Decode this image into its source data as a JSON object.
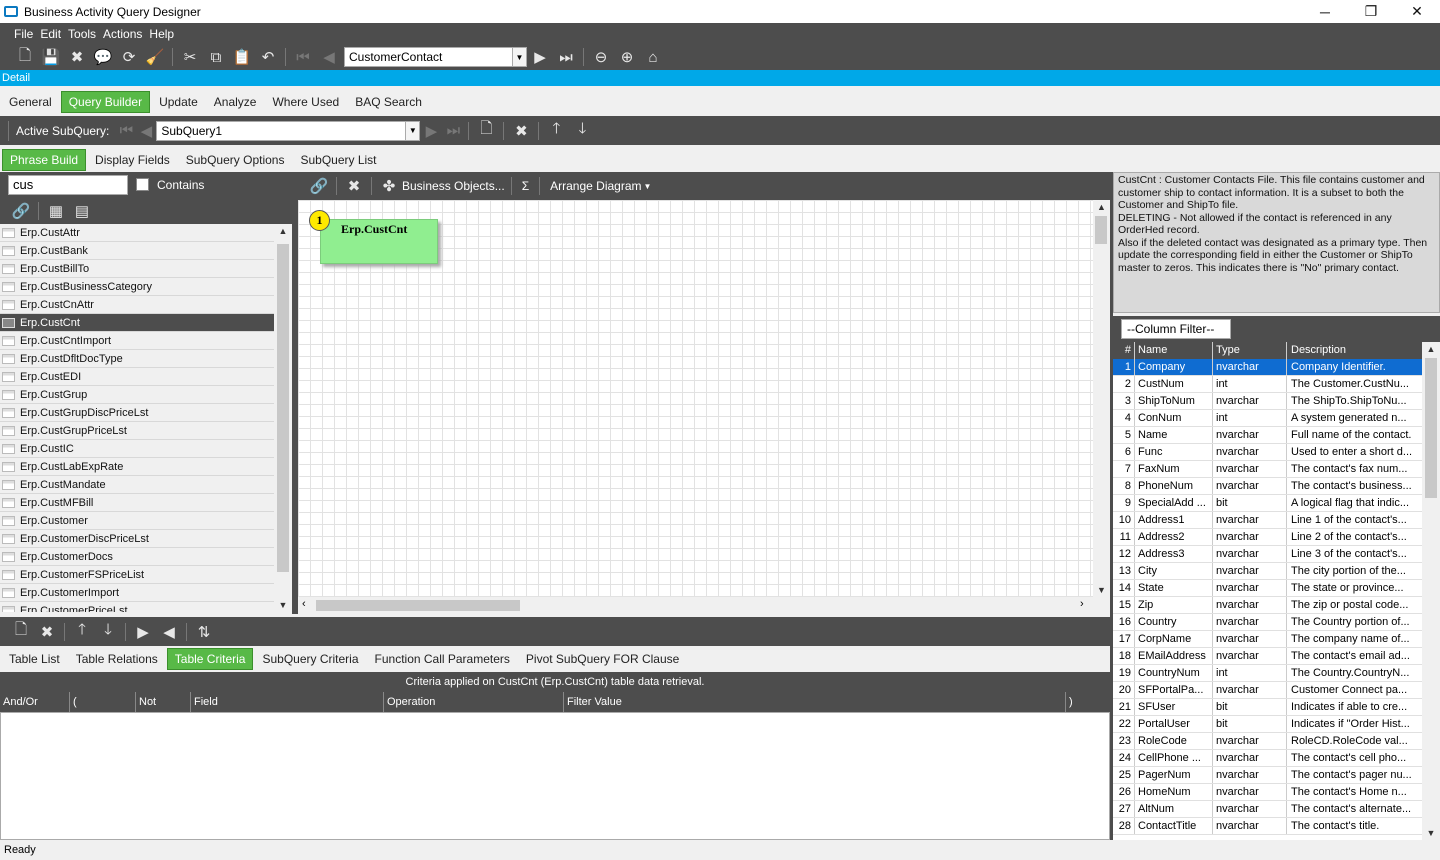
{
  "window": {
    "title": "Business Activity Query Designer",
    "minimize_glyph": "─",
    "restore_glyph": "❐",
    "close_glyph": "✕"
  },
  "menu": [
    "File",
    "Edit",
    "Tools",
    "Actions",
    "Help"
  ],
  "toolbar": {
    "query_id": "CustomerContact"
  },
  "detail_label": "Detail",
  "main_tabs": [
    "General",
    "Query Builder",
    "Update",
    "Analyze",
    "Where Used",
    "BAQ Search"
  ],
  "main_tabs_active": "Query Builder",
  "subquery": {
    "label": "Active SubQuery:",
    "value": "SubQuery1"
  },
  "phrase_tabs": [
    "Phrase Build",
    "Display Fields",
    "SubQuery Options",
    "SubQuery List"
  ],
  "search": {
    "value": "cus",
    "contains_label": "Contains"
  },
  "tables": [
    "Erp.CustAttr",
    "Erp.CustBank",
    "Erp.CustBillTo",
    "Erp.CustBusinessCategory",
    "Erp.CustCnAttr",
    "Erp.CustCnt",
    "Erp.CustCntImport",
    "Erp.CustDfltDocType",
    "Erp.CustEDI",
    "Erp.CustGrup",
    "Erp.CustGrupDiscPriceLst",
    "Erp.CustGrupPriceLst",
    "Erp.CustIC",
    "Erp.CustLabExpRate",
    "Erp.CustMandate",
    "Erp.CustMFBill",
    "Erp.Customer",
    "Erp.CustomerDiscPriceLst",
    "Erp.CustomerDocs",
    "Erp.CustomerFSPriceList",
    "Erp.CustomerImport",
    "Erp.CustomerPriceLst"
  ],
  "tables_selected": "Erp.CustCnt",
  "diagram": {
    "business_objects": "Business Objects...",
    "sigma": "Σ",
    "arrange": "Arrange Diagram",
    "node_number": "1",
    "node_label": "Erp.CustCnt"
  },
  "bottom_tabs": [
    "Table List",
    "Table Relations",
    "Table Criteria",
    "SubQuery Criteria",
    "Function Call Parameters",
    "Pivot SubQuery FOR Clause"
  ],
  "bottom_tabs_active": "Table Criteria",
  "criteria": {
    "caption": "Criteria applied on CustCnt (Erp.CustCnt)  table data retrieval.",
    "columns": [
      "And/Or",
      "(",
      "Not",
      "Field",
      "Operation",
      "Filter Value",
      ")"
    ]
  },
  "status": "Ready",
  "description": "CustCnt : Customer Contacts File. This file contains customer and customer ship to contact information. It is a subset to both the Customer and ShipTo file.\nDELETING - Not allowed if the contact is referenced in any OrderHed record.\nAlso if the deleted contact was designated as a primary type. Then update the corresponding field in either the Customer or ShipTo master to zeros. This indicates there is \"No\" primary contact.",
  "column_filter": "--Column Filter--",
  "columns_grid": {
    "headers": [
      "#",
      "Name",
      "Type",
      "Description"
    ],
    "rows": [
      [
        "1",
        "Company",
        "nvarchar",
        "Company Identifier."
      ],
      [
        "2",
        "CustNum",
        "int",
        "The  Customer.CustNu..."
      ],
      [
        "3",
        "ShipToNum",
        "nvarchar",
        "The  ShipTo.ShipToNu..."
      ],
      [
        "4",
        "ConNum",
        "int",
        "A system generated n..."
      ],
      [
        "5",
        "Name",
        "nvarchar",
        "Full name of the contact."
      ],
      [
        "6",
        "Func",
        "nvarchar",
        "Used to enter a short d..."
      ],
      [
        "7",
        "FaxNum",
        "nvarchar",
        "The contact's fax num..."
      ],
      [
        "8",
        "PhoneNum",
        "nvarchar",
        "The contact's business..."
      ],
      [
        "9",
        "SpecialAdd ...",
        "bit",
        "A logical flag that indic..."
      ],
      [
        "10",
        "Address1",
        "nvarchar",
        "Line 1 of the contact's..."
      ],
      [
        "11",
        "Address2",
        "nvarchar",
        "Line 2 of the contact's..."
      ],
      [
        "12",
        "Address3",
        "nvarchar",
        "Line 3 of the contact's..."
      ],
      [
        "13",
        "City",
        "nvarchar",
        "The city portion of the..."
      ],
      [
        "14",
        "State",
        "nvarchar",
        "The state or province..."
      ],
      [
        "15",
        "Zip",
        "nvarchar",
        "The zip or postal code..."
      ],
      [
        "16",
        "Country",
        "nvarchar",
        "The Country portion of..."
      ],
      [
        "17",
        "CorpName",
        "nvarchar",
        "The company name of..."
      ],
      [
        "18",
        "EMailAddress",
        "nvarchar",
        "The contact's email ad..."
      ],
      [
        "19",
        "CountryNum",
        "int",
        "The  Country.CountryN..."
      ],
      [
        "20",
        "SFPortalPa...",
        "nvarchar",
        "Customer  Connect  pa..."
      ],
      [
        "21",
        "SFUser",
        "bit",
        "Indicates if able to cre..."
      ],
      [
        "22",
        "PortalUser",
        "bit",
        "Indicates if \"Order Hist..."
      ],
      [
        "23",
        "RoleCode",
        "nvarchar",
        "RoleCD.RoleCode  val..."
      ],
      [
        "24",
        "CellPhone ...",
        "nvarchar",
        "The contact's cell pho..."
      ],
      [
        "25",
        "PagerNum",
        "nvarchar",
        "The contact's pager nu..."
      ],
      [
        "26",
        "HomeNum",
        "nvarchar",
        "The contact's Home  n..."
      ],
      [
        "27",
        "AltNum",
        "nvarchar",
        "The contact's alternate..."
      ],
      [
        "28",
        "ContactTitle",
        "nvarchar",
        "The contact's title."
      ]
    ],
    "selected_row": "1"
  },
  "colors": {
    "accent_green": "#58b947",
    "detail_blue": "#00a8e8",
    "dark_bar": "#4d4d4d",
    "selection_blue": "#0f6cd1",
    "node_green": "#90ee90"
  }
}
